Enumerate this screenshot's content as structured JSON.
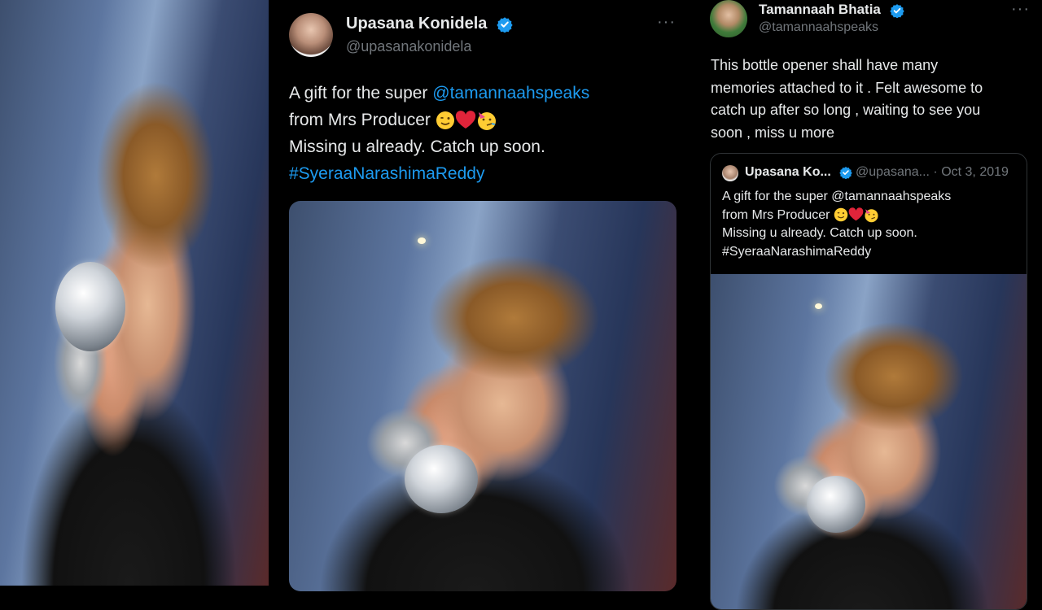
{
  "tweet1": {
    "display_name": "Upasana Konidela",
    "handle": "@upasanakonidela",
    "text_line1_prefix": "A  gift for the super ",
    "mention": "@tamannaahspeaks",
    "text_line2": "from Mrs Producer",
    "emojis": [
      "wink-face",
      "red-heart",
      "partying-face"
    ],
    "text_line3": "Missing u already. Catch up soon.",
    "hashtag": "#SyeraaNarashimaReddy",
    "more_label": "···"
  },
  "tweet2": {
    "display_name": "Tamannaah Bhatia",
    "handle": "@tamannaahspeaks",
    "text_lines": [
      "This bottle opener shall have many",
      "memories attached to it . Felt awesome to",
      "catch up after so long , waiting to see you",
      "soon , miss u more"
    ],
    "more_label": "···"
  },
  "quoted_tweet": {
    "display_name": "Upasana Ko...",
    "handle_date": "@upasana... · Oct 3, 2019",
    "text_line1": "A  gift for the super @tamannaahspeaks",
    "text_line2": "from Mrs Producer",
    "text_line3": "Missing u already. Catch up soon.",
    "text_line4": "#SyeraaNarashimaReddy"
  },
  "colors": {
    "background": "#000000",
    "text": "#e7e9ea",
    "muted": "#71767b",
    "link": "#1d9bf0",
    "verified": "#1d9bf0",
    "border": "#2f3336"
  },
  "icons": [
    "verified-badge-icon",
    "more-options-icon"
  ]
}
